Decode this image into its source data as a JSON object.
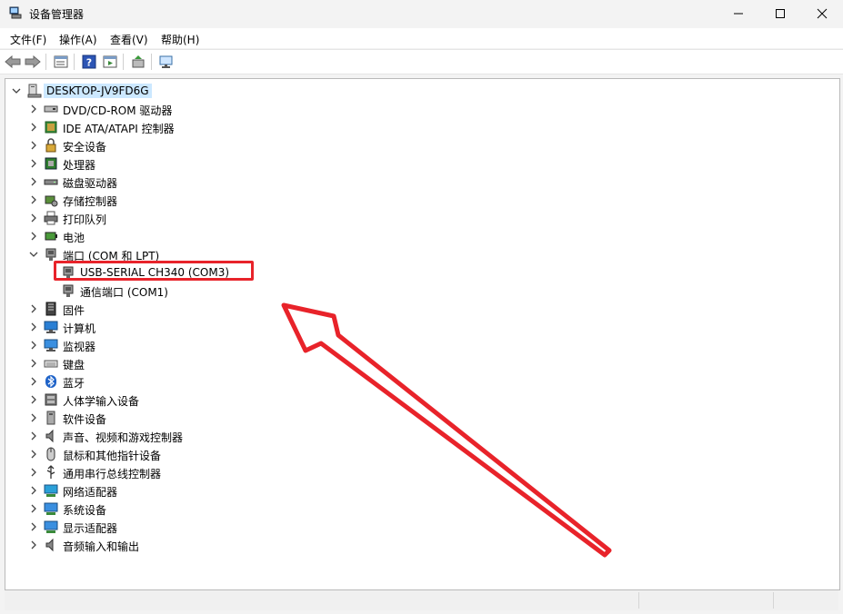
{
  "window": {
    "title": "设备管理器",
    "minimize_icon": "minimize-icon",
    "maximize_icon": "maximize-icon",
    "close_icon": "close-icon"
  },
  "menu": [
    "文件(F)",
    "操作(A)",
    "查看(V)",
    "帮助(H)"
  ],
  "toolbar": [
    "back-arrow-icon",
    "forward-arrow-icon",
    "properties-icon",
    "help-icon",
    "show-hidden-icon",
    "update-driver-icon",
    "scan-hardware-icon"
  ],
  "tree": {
    "root": {
      "label": "DESKTOP-JV9FD6G",
      "icon": "computer-icon",
      "expanded": true
    },
    "categories": [
      {
        "label": "DVD/CD-ROM 驱动器",
        "icon": "dvd-drive-icon",
        "expanded": false
      },
      {
        "label": "IDE ATA/ATAPI 控制器",
        "icon": "ide-controller-icon",
        "expanded": false
      },
      {
        "label": "安全设备",
        "icon": "security-device-icon",
        "expanded": false
      },
      {
        "label": "处理器",
        "icon": "processor-icon",
        "expanded": false
      },
      {
        "label": "磁盘驱动器",
        "icon": "disk-drive-icon",
        "expanded": false
      },
      {
        "label": "存储控制器",
        "icon": "storage-controller-icon",
        "expanded": false
      },
      {
        "label": "打印队列",
        "icon": "printer-icon",
        "expanded": false
      },
      {
        "label": "电池",
        "icon": "battery-icon",
        "expanded": false
      },
      {
        "label": "端口 (COM 和 LPT)",
        "icon": "port-icon",
        "expanded": true,
        "children": [
          {
            "label": "USB-SERIAL CH340 (COM3)",
            "icon": "port-icon",
            "highlighted": true
          },
          {
            "label": "通信端口 (COM1)",
            "icon": "port-icon"
          }
        ]
      },
      {
        "label": "固件",
        "icon": "firmware-icon",
        "expanded": false
      },
      {
        "label": "计算机",
        "icon": "computer-icon",
        "expanded": false
      },
      {
        "label": "监视器",
        "icon": "monitor-icon",
        "expanded": false
      },
      {
        "label": "键盘",
        "icon": "keyboard-icon",
        "expanded": false
      },
      {
        "label": "蓝牙",
        "icon": "bluetooth-icon",
        "expanded": false
      },
      {
        "label": "人体学输入设备",
        "icon": "hid-icon",
        "expanded": false
      },
      {
        "label": "软件设备",
        "icon": "software-device-icon",
        "expanded": false
      },
      {
        "label": "声音、视频和游戏控制器",
        "icon": "sound-icon",
        "expanded": false
      },
      {
        "label": "鼠标和其他指针设备",
        "icon": "mouse-icon",
        "expanded": false
      },
      {
        "label": "通用串行总线控制器",
        "icon": "usb-icon",
        "expanded": false
      },
      {
        "label": "网络适配器",
        "icon": "network-adapter-icon",
        "expanded": false
      },
      {
        "label": "系统设备",
        "icon": "system-device-icon",
        "expanded": false
      },
      {
        "label": "显示适配器",
        "icon": "display-adapter-icon",
        "expanded": false
      },
      {
        "label": "音频输入和输出",
        "icon": "audio-io-icon",
        "expanded": false
      }
    ]
  },
  "annotation": {
    "highlight_color": "#e8232a",
    "arrow_color": "#e8232a",
    "arrow_icon": "annotation-arrow-icon"
  },
  "colors": {
    "selection": "#cce8ff",
    "window_bg": "#f3f3f3"
  }
}
